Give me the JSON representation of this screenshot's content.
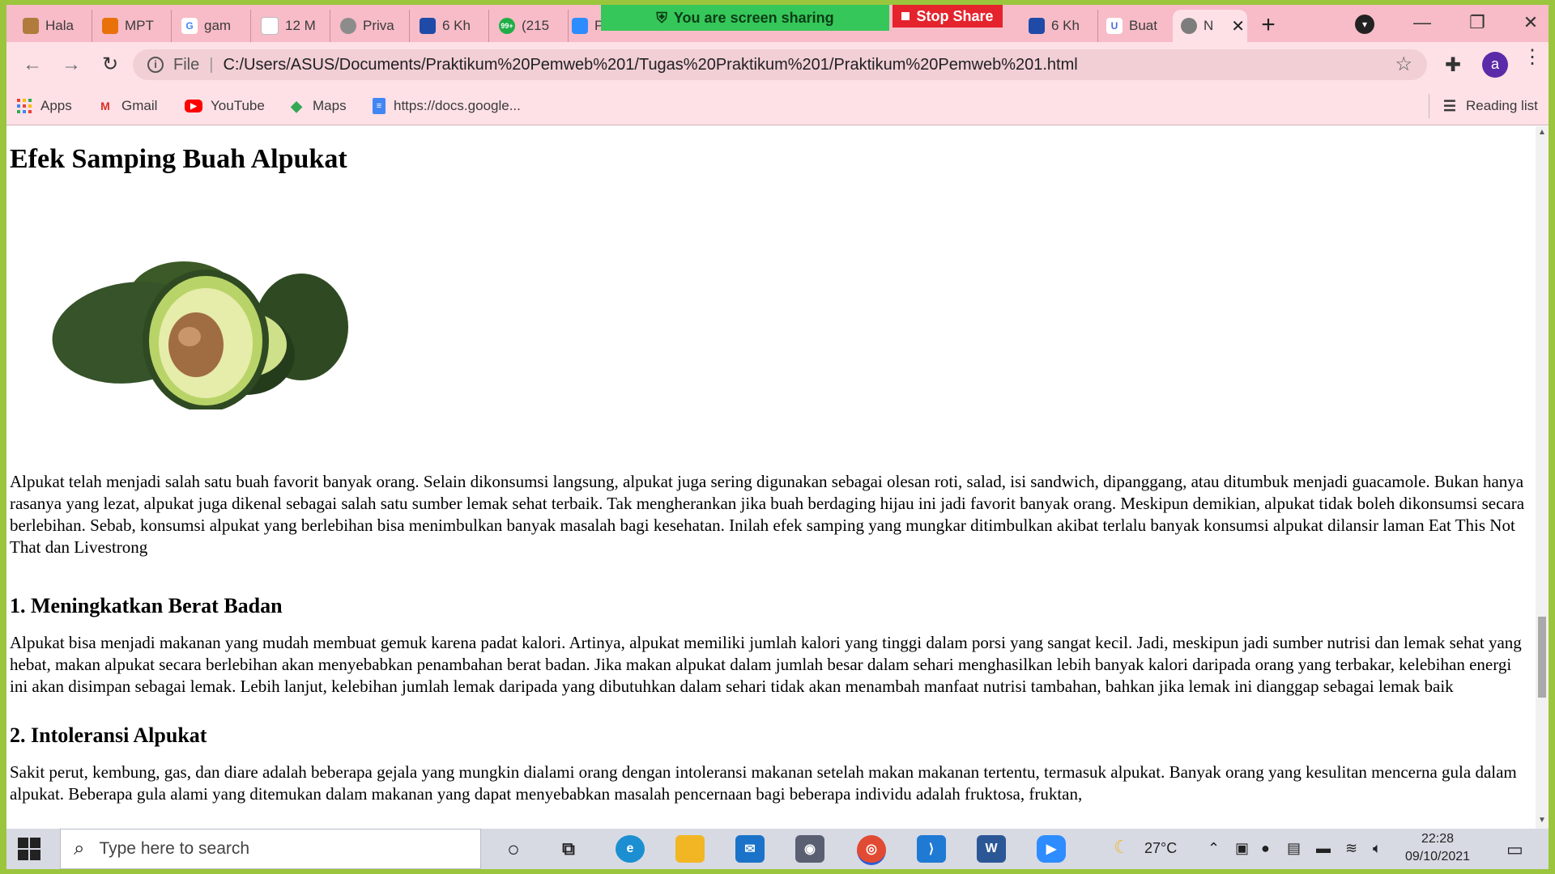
{
  "tabs": [
    {
      "title": "Hala",
      "fav_color": "#b07b3c",
      "fav_glyph": ""
    },
    {
      "title": "MPT",
      "fav_color": "#e8710a",
      "fav_glyph": ""
    },
    {
      "title": "gam",
      "fav_color": "#ffffff",
      "fav_glyph": "G"
    },
    {
      "title": "12 M",
      "fav_color": "#ffffff",
      "fav_glyph": ""
    },
    {
      "title": "Priva",
      "fav_color": "#8c8c8c",
      "fav_glyph": ""
    },
    {
      "title": "6 Kh",
      "fav_color": "#1f4aa8",
      "fav_glyph": ""
    },
    {
      "title": "(215",
      "fav_color": "#1fae46",
      "fav_glyph": "99+"
    },
    {
      "title": "Po",
      "fav_color": "#2d8cff",
      "fav_glyph": ""
    },
    {
      "title": "6 Kh",
      "fav_color": "#1f4aa8",
      "fav_glyph": ""
    },
    {
      "title": "Buat",
      "fav_color": "#4f6bd8",
      "fav_glyph": "U"
    },
    {
      "title": "N",
      "fav_color": "#7d7d7d",
      "fav_glyph": ""
    }
  ],
  "share": {
    "banner_text": "You are screen sharing",
    "stop_label": "Stop Share"
  },
  "omnibox": {
    "scheme_label": "File",
    "url": "C:/Users/ASUS/Documents/Praktikum%20Pemweb%201/Tugas%20Praktikum%201/Praktikum%20Pemweb%201.html"
  },
  "profile": {
    "initial": "a",
    "color": "#5b2aa8"
  },
  "bookmarks": {
    "items": [
      {
        "label": "Apps",
        "icon": "apps-grid-icon"
      },
      {
        "label": "Gmail",
        "icon": "gmail-icon"
      },
      {
        "label": "YouTube",
        "icon": "youtube-icon"
      },
      {
        "label": "Maps",
        "icon": "maps-icon"
      },
      {
        "label": "https://docs.google...",
        "icon": "docs-icon"
      }
    ],
    "reading_list": "Reading list"
  },
  "article": {
    "title": "Efek Samping Buah Alpukat",
    "intro": "Alpukat telah menjadi salah satu buah favorit banyak orang. Selain dikonsumsi langsung, alpukat juga sering digunakan sebagai olesan roti, salad, isi sandwich, dipanggang, atau ditumbuk menjadi guacamole. Bukan hanya rasanya yang lezat, alpukat juga dikenal sebagai salah satu sumber lemak sehat terbaik. Tak mengherankan jika buah berdaging hijau ini jadi favorit banyak orang. Meskipun demikian, alpukat tidak boleh dikonsumsi secara berlebihan. Sebab, konsumsi alpukat yang berlebihan bisa menimbulkan banyak masalah bagi kesehatan. Inilah efek samping yang mungkar ditimbulkan akibat terlalu banyak konsumsi alpukat dilansir laman Eat This Not That dan Livestrong",
    "sections": [
      {
        "heading": "1. Meningkatkan Berat Badan",
        "body": "Alpukat bisa menjadi makanan yang mudah membuat gemuk karena padat kalori. Artinya, alpukat memiliki jumlah kalori yang tinggi dalam porsi yang sangat kecil. Jadi, meskipun jadi sumber nutrisi dan lemak sehat yang hebat, makan alpukat secara berlebihan akan menyebabkan penambahan berat badan. Jika makan alpukat dalam jumlah besar dalam sehari menghasilkan lebih banyak kalori daripada orang yang terbakar, kelebihan energi ini akan disimpan sebagai lemak. Lebih lanjut, kelebihan jumlah lemak daripada yang dibutuhkan dalam sehari tidak akan menambah manfaat nutrisi tambahan, bahkan jika lemak ini dianggap sebagai lemak baik"
      },
      {
        "heading": "2. Intoleransi Alpukat",
        "body": "Sakit perut, kembung, gas, dan diare adalah beberapa gejala yang mungkin dialami orang dengan intoleransi makanan setelah makan makanan tertentu, termasuk alpukat. Banyak orang yang kesulitan mencerna gula dalam alpukat. Beberapa gula alami yang ditemukan dalam makanan yang dapat menyebabkan masalah pencernaan bagi beberapa individu adalah fruktosa, fruktan,"
      }
    ]
  },
  "taskbar": {
    "search_placeholder": "Type here to search",
    "weather": "27°C",
    "time": "22:28",
    "date": "09/10/2021"
  }
}
